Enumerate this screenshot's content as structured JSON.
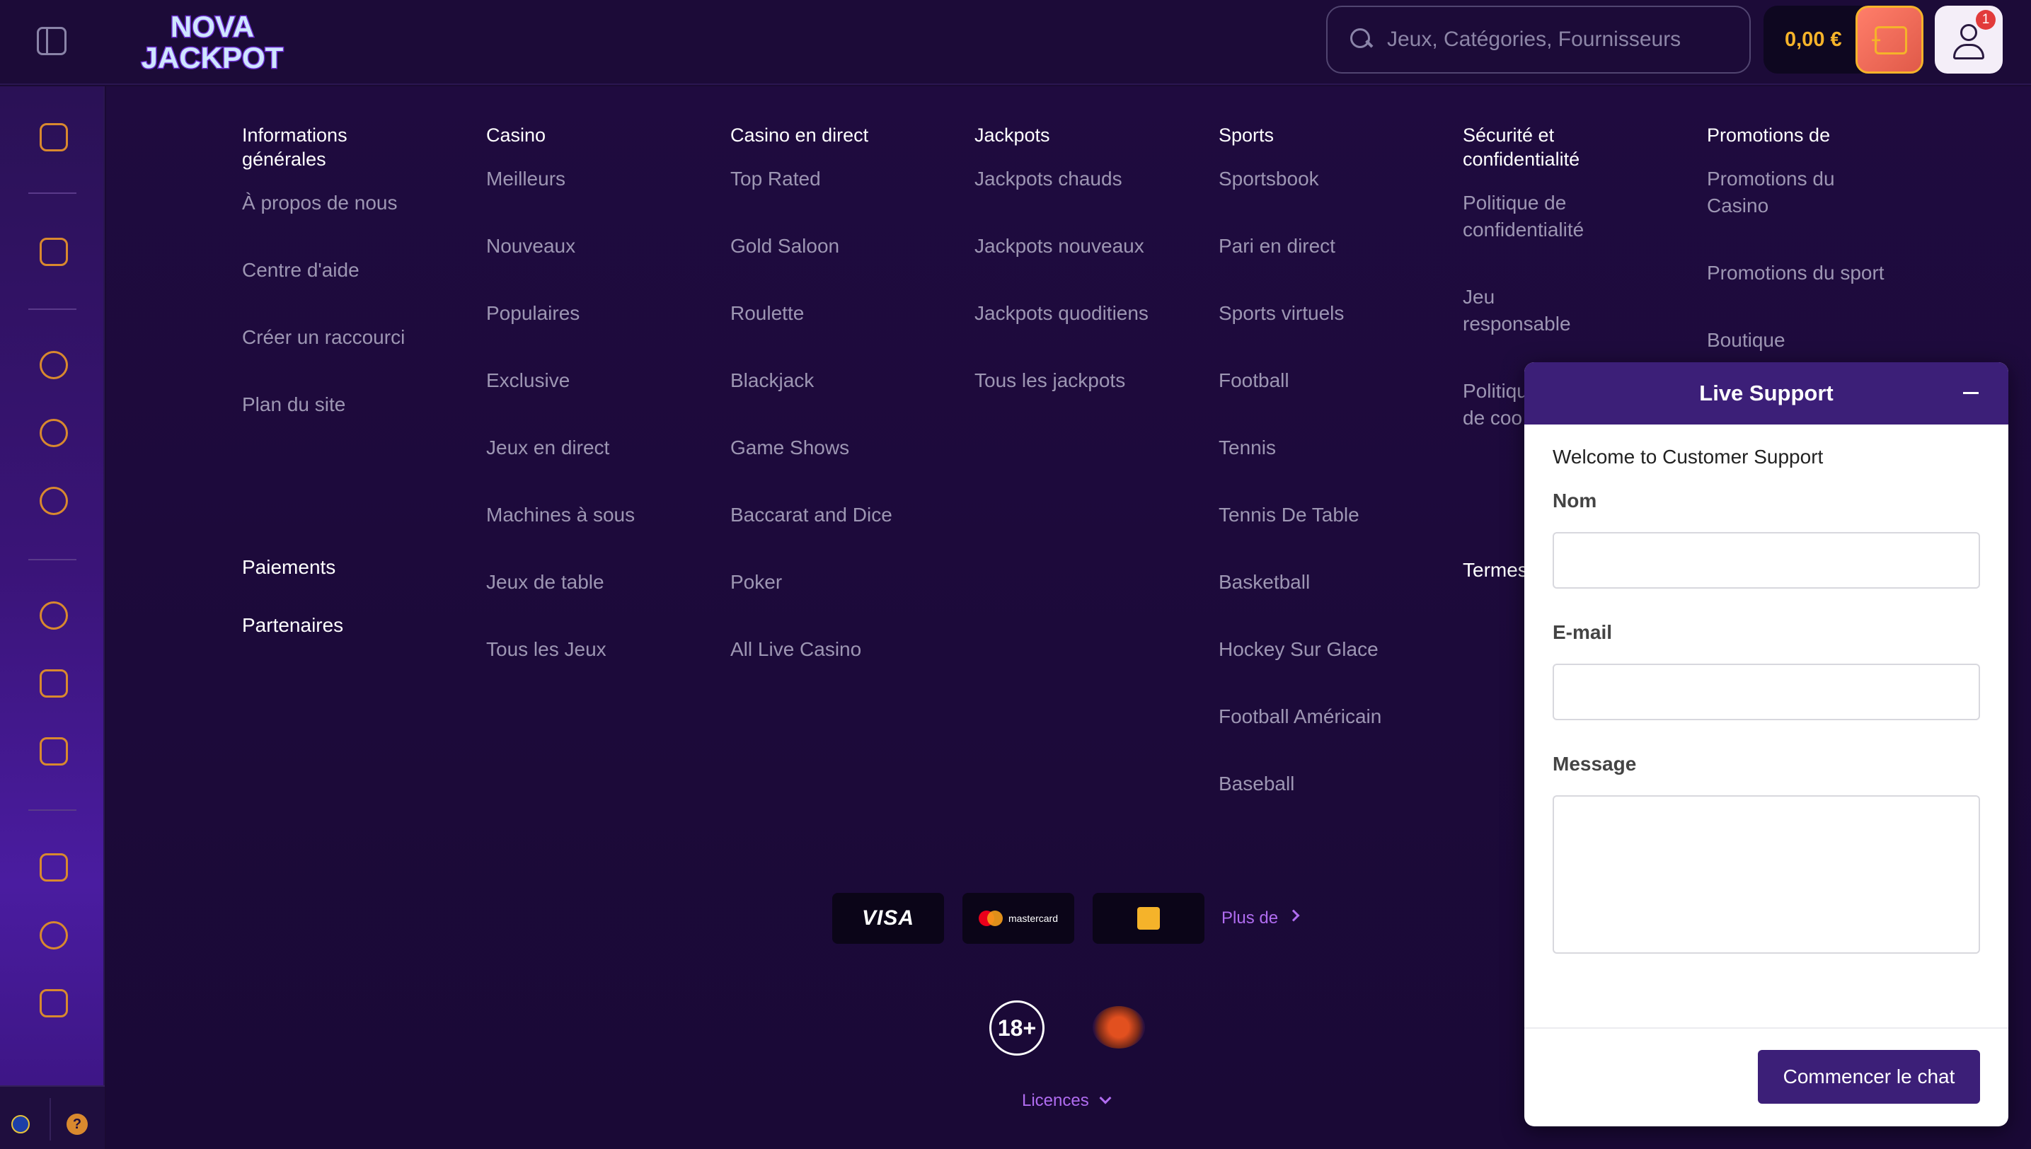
{
  "header": {
    "logo_line1": "NOVA",
    "logo_line2": "JACKPOT",
    "search_placeholder": "Jeux, Catégories, Fournisseurs",
    "balance": "0,00 €",
    "notification_count": "1"
  },
  "footer_columns": [
    {
      "heading": "Informations générales",
      "items": [
        "À propos de nous",
        "Centre d'aide",
        "Créer un raccourci",
        "Plan du site"
      ]
    },
    {
      "heading": "Casino",
      "items": [
        "Meilleurs",
        "Nouveaux",
        "Populaires",
        "Exclusive",
        "Jeux en direct",
        "Machines à sous",
        "Jeux de table",
        "Tous les Jeux"
      ]
    },
    {
      "heading": "Casino en direct",
      "items": [
        "Top Rated",
        "Gold Saloon",
        "Roulette",
        "Blackjack",
        "Game Shows",
        "Baccarat and Dice",
        "Poker",
        "All Live Casino"
      ]
    },
    {
      "heading": "Jackpots",
      "items": [
        "Jackpots chauds",
        "Jackpots nouveaux",
        "Jackpots quoditiens",
        "Tous les jackpots"
      ]
    },
    {
      "heading": "Sports",
      "items": [
        "Sportsbook",
        "Pari en direct",
        "Sports virtuels",
        "Football",
        "Tennis",
        "Tennis De Table",
        "Basketball",
        "Hockey Sur Glace",
        "Football Américain",
        "Baseball"
      ]
    },
    {
      "heading": "Sécurité et confidentialité",
      "items": [
        "Politique de confidentialité",
        "Jeu responsable",
        "Politiqu de coo"
      ]
    },
    {
      "heading": "Promotions de",
      "items": [
        "Promotions du Casino",
        "Promotions du sport",
        "Boutique"
      ]
    }
  ],
  "extra_links": {
    "payments": "Paiements",
    "partners": "Partenaires",
    "terms": "Termes"
  },
  "payments": {
    "visa": "VISA",
    "mastercard": "mastercard",
    "more": "Plus de"
  },
  "age_badge": "18+",
  "licences": "Licences",
  "support": {
    "title": "Live Support",
    "welcome": "Welcome to Customer Support",
    "name_label": "Nom",
    "email_label": "E-mail",
    "message_label": "Message",
    "start_button": "Commencer le chat"
  },
  "colors": {
    "accent_orange": "#d9892e",
    "balance_yellow": "#f5b32a",
    "link_purple": "#b06cf0",
    "support_purple": "#3c1f78"
  }
}
